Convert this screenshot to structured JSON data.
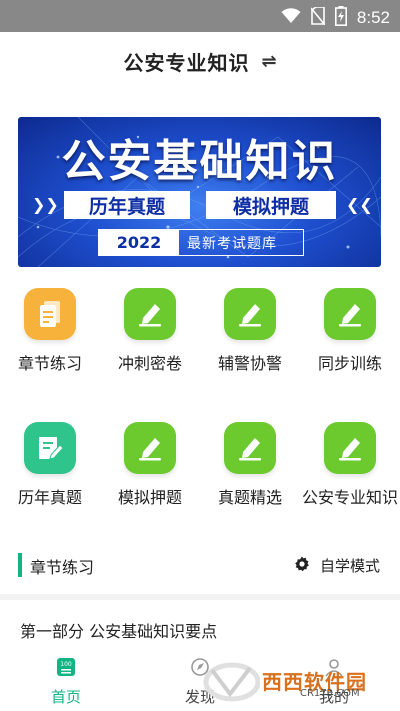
{
  "status_bar": {
    "time": "8:52",
    "icons": [
      "wifi-icon",
      "no-sim-icon",
      "battery-charging-icon"
    ]
  },
  "header": {
    "title": "公安专业知识",
    "switch_icon": "swap-icon",
    "switch_glyph": "⇌"
  },
  "banner": {
    "title": "公安基础知识",
    "tags": [
      "历年真题",
      "模拟押题"
    ],
    "year": "2022",
    "subtitle": "最新考试题库",
    "colors": {
      "bg": "#1e4fcf",
      "accent": "#ffffff"
    }
  },
  "grid": {
    "items": [
      {
        "label": "章节练习",
        "icon": "document-icon",
        "color": "#f6b23a"
      },
      {
        "label": "冲刺密卷",
        "icon": "edit-pen-icon",
        "color": "#6cc92e"
      },
      {
        "label": "辅警协警",
        "icon": "edit-pen-icon",
        "color": "#6cc92e"
      },
      {
        "label": "同步训练",
        "icon": "edit-pen-icon",
        "color": "#6cc92e"
      },
      {
        "label": "历年真题",
        "icon": "note-edit-icon",
        "color": "#2fc48b"
      },
      {
        "label": "模拟押题",
        "icon": "edit-pen-icon",
        "color": "#6cc92e"
      },
      {
        "label": "真题精选",
        "icon": "edit-pen-icon",
        "color": "#6cc92e"
      },
      {
        "label": "公安专业知识",
        "icon": "edit-pen-icon",
        "color": "#6cc92e"
      }
    ]
  },
  "section": {
    "title": "章节练习",
    "mode_label": "自学模式",
    "accent": "#14b384"
  },
  "chapters": [
    {
      "title": "第一部分 公安基础知识要点"
    }
  ],
  "bottom_nav": {
    "items": [
      {
        "label": "首页",
        "icon": "home-book-icon",
        "active": true
      },
      {
        "label": "发现",
        "icon": "discover-icon",
        "active": false
      },
      {
        "label": "我的",
        "icon": "profile-icon",
        "active": false
      }
    ]
  },
  "watermark": {
    "text": "西西软件园",
    "url": "CR173.COM"
  }
}
